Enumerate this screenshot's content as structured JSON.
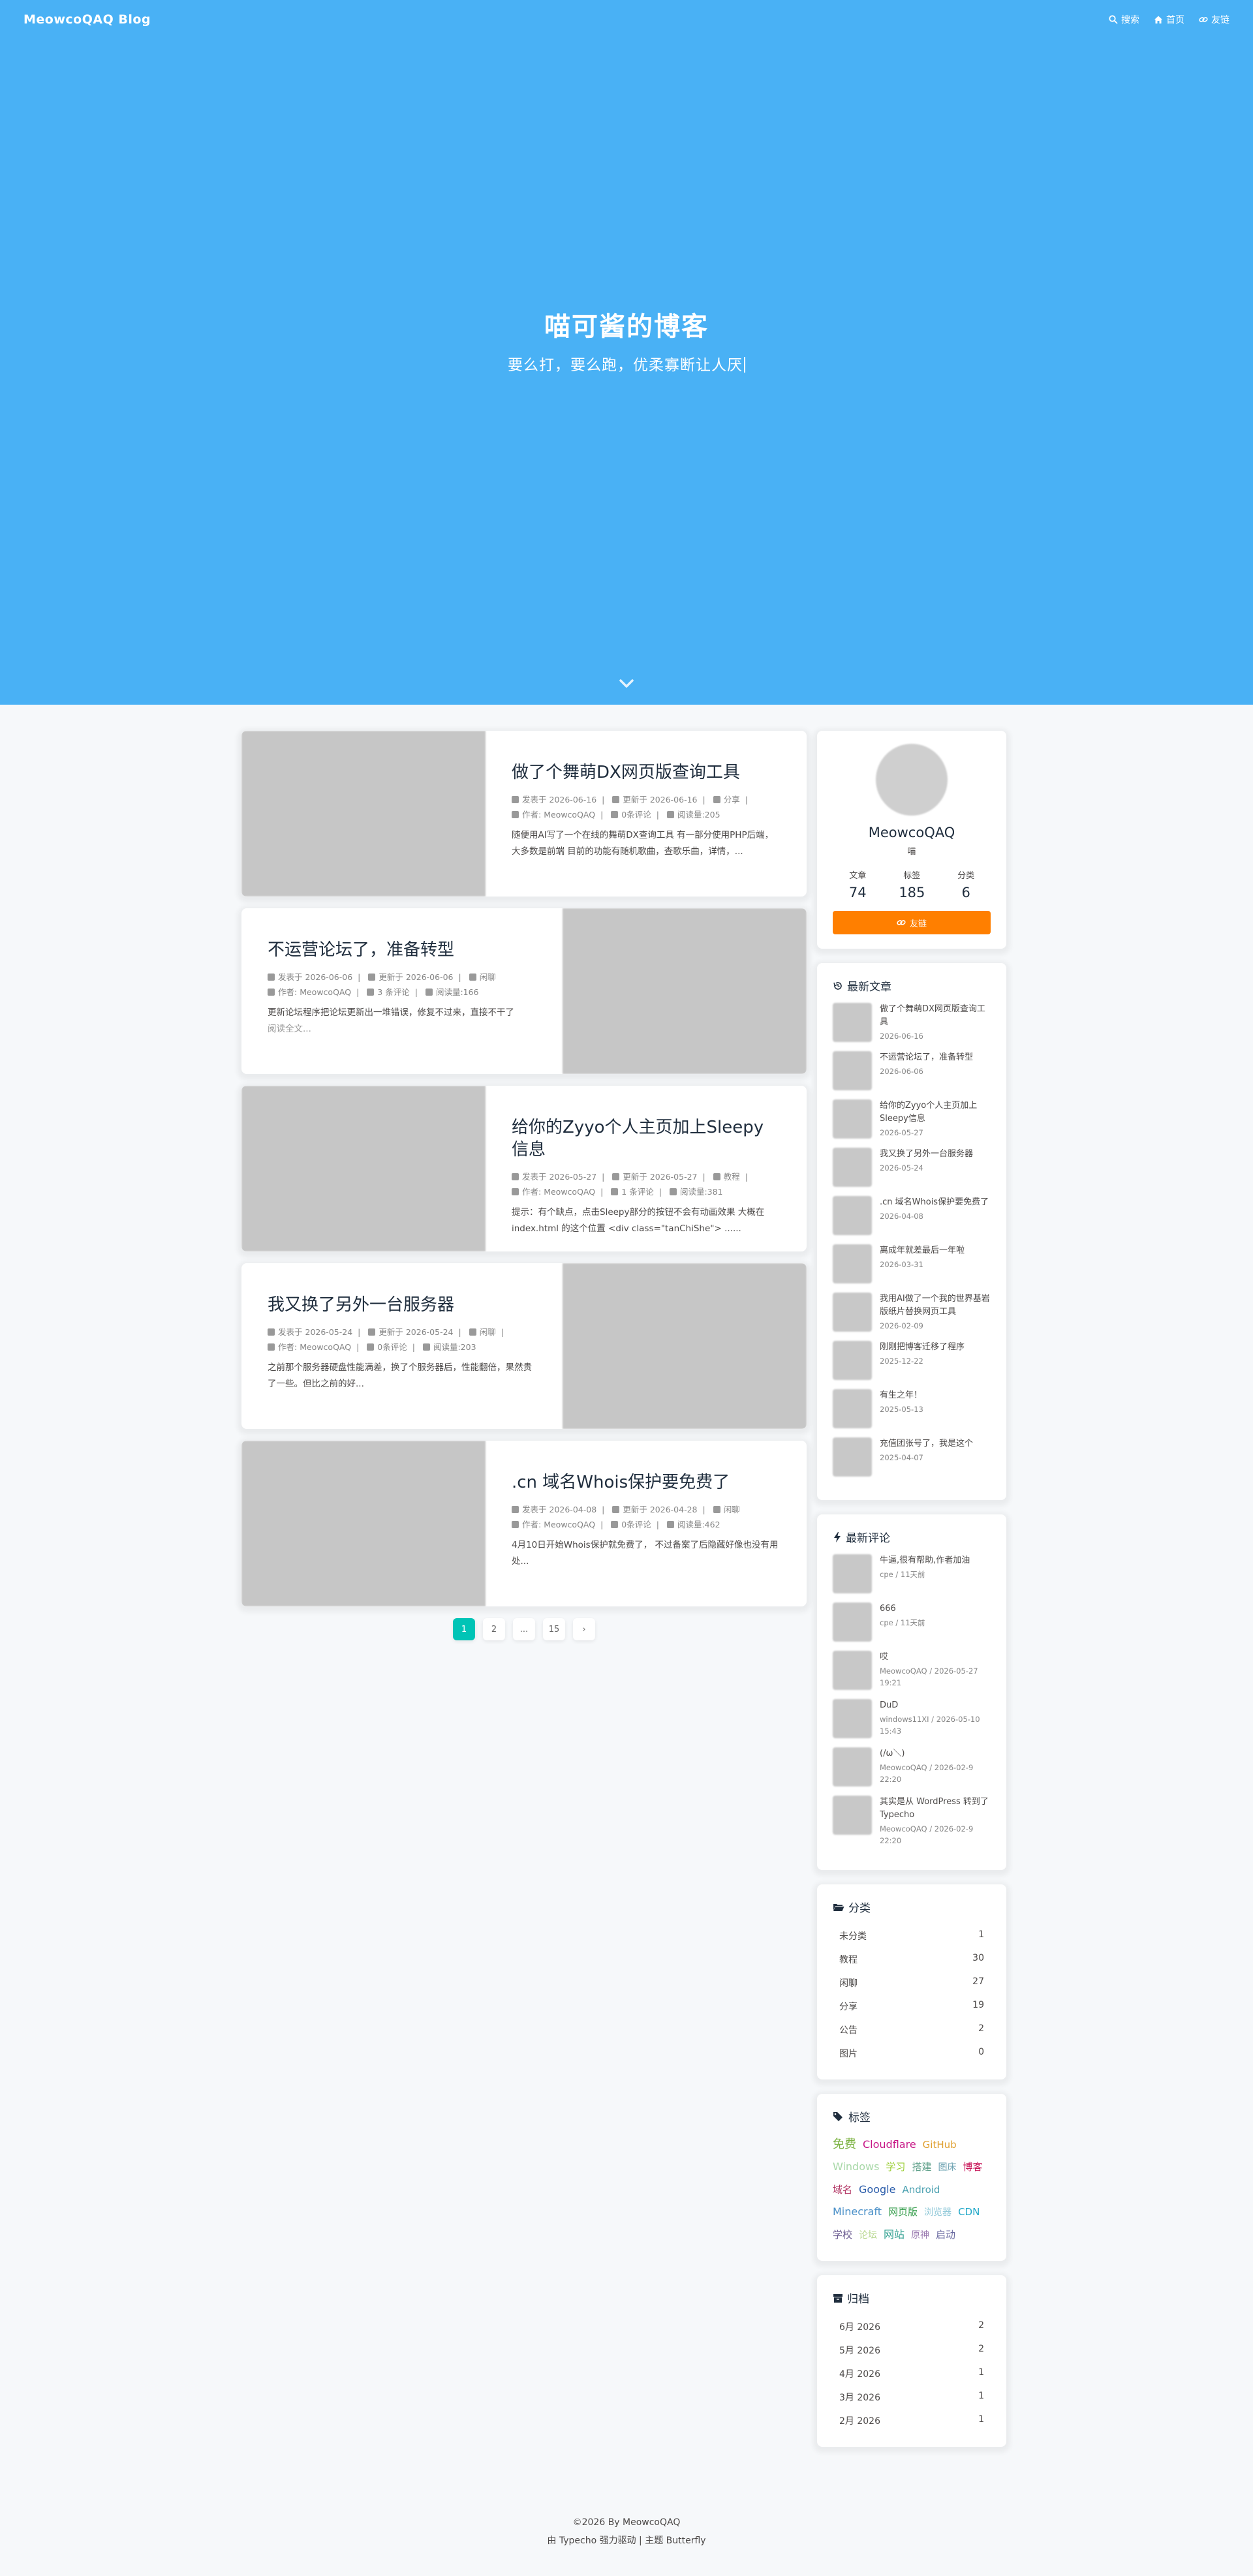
{
  "nav": {
    "brand": "MeowcoQAQ Blog",
    "search": "搜索",
    "home": "首页",
    "friends": "友链"
  },
  "hero": {
    "title": "喵可酱的博客",
    "subtitle": "要么打，要么跑，优柔寡断让人厌"
  },
  "posts": [
    {
      "title": "做了个舞萌DX网页版查询工具",
      "published": "2026-06-16",
      "updated": "2026-06-16",
      "category": "分享",
      "author": "MeowcoQAQ",
      "comments": "0条评论",
      "views": "阅读量:205",
      "excerpt": "随便用AI写了一个在线的舞萌DX查询工具 有一部分使用PHP后端，大多数是前端 目前的功能有随机歌曲，查歌乐曲，详情，...",
      "more": ""
    },
    {
      "title": "不运营论坛了，准备转型",
      "published": "2026-06-06",
      "updated": "2026-06-06",
      "category": "闲聊",
      "author": "MeowcoQAQ",
      "comments": "3 条评论",
      "views": "阅读量:166",
      "excerpt": "更新论坛程序把论坛更新出一堆错误，修复不过来，直接不干了",
      "more": "阅读全文..."
    },
    {
      "title": "给你的Zyyo个人主页加上Sleepy信息",
      "published": "2026-05-27",
      "updated": "2026-05-27",
      "category": "教程",
      "author": "MeowcoQAQ",
      "comments": "1 条评论",
      "views": "阅读量:381",
      "excerpt": "提示：有个缺点，点击Sleepy部分的按钮不会有动画效果 大概在index.html 的这个位置 <div class=\"tanChiShe\"> ......",
      "more": ""
    },
    {
      "title": "我又换了另外一台服务器",
      "published": "2026-05-24",
      "updated": "2026-05-24",
      "category": "闲聊",
      "author": "MeowcoQAQ",
      "comments": "0条评论",
      "views": "阅读量:203",
      "excerpt": "之前那个服务器硬盘性能满差，换了个服务器后，性能翻倍，果然贵了一些。但比之前的好...",
      "more": ""
    },
    {
      "title": ".cn 域名Whois保护要免费了",
      "published": "2026-04-08",
      "updated": "2026-04-28",
      "category": "闲聊",
      "author": "MeowcoQAQ",
      "comments": "0条评论",
      "views": "阅读量:462",
      "excerpt": "4月10日开始Whois保护就免费了， 不过备案了后隐藏好像也没有用处...",
      "more": ""
    }
  ],
  "meta_labels": {
    "published": "发表于",
    "updated": "更新于",
    "author": "作者:"
  },
  "pager": {
    "p1": "1",
    "p2": "2",
    "dots": "...",
    "last": "15",
    "next": "›"
  },
  "author": {
    "name": "MeowcoQAQ",
    "desc": "喵",
    "posts_label": "文章",
    "posts": "74",
    "tags_label": "标签",
    "tags": "185",
    "cats_label": "分类",
    "cats": "6",
    "link_btn": "友链"
  },
  "recent_posts": {
    "title": "最新文章",
    "items": [
      {
        "t": "做了个舞萌DX网页版查询工具",
        "d": "2026-06-16"
      },
      {
        "t": "不运营论坛了，准备转型",
        "d": "2026-06-06"
      },
      {
        "t": "给你的Zyyo个人主页加上Sleepy信息",
        "d": "2026-05-27"
      },
      {
        "t": "我又换了另外一台服务器",
        "d": "2026-05-24"
      },
      {
        "t": ".cn 域名Whois保护要免费了",
        "d": "2026-04-08"
      },
      {
        "t": "离成年就差最后一年啦",
        "d": "2026-03-31"
      },
      {
        "t": "我用AI做了一个我的世界基岩版纸片替换网页工具",
        "d": "2026-02-09"
      },
      {
        "t": "刚刚把博客迁移了程序",
        "d": "2025-12-22"
      },
      {
        "t": "有生之年！",
        "d": "2025-05-13"
      },
      {
        "t": "充值团张号了，我是这个",
        "d": "2025-04-07"
      }
    ]
  },
  "recent_comments": {
    "title": "最新评论",
    "items": [
      {
        "t": "牛逼,很有帮助,作者加油",
        "d": "cpe / 11天前"
      },
      {
        "t": "666",
        "d": "cpe / 11天前"
      },
      {
        "t": "哎",
        "d": "MeowcoQAQ / 2026-05-27 19:21"
      },
      {
        "t": "DuD",
        "d": "windows11XI / 2026-05-10 15:43"
      },
      {
        "t": "(/ω＼)",
        "d": "MeowcoQAQ / 2026-02-9 22:20"
      },
      {
        "t": "其实是从 WordPress 转到了 Typecho",
        "d": "MeowcoQAQ / 2026-02-9 22:20"
      }
    ]
  },
  "categories": {
    "title": "分类",
    "items": [
      {
        "name": "未分类",
        "count": "1"
      },
      {
        "name": "教程",
        "count": "30"
      },
      {
        "name": "闲聊",
        "count": "27"
      },
      {
        "name": "分享",
        "count": "19"
      },
      {
        "name": "公告",
        "count": "2"
      },
      {
        "name": "图片",
        "count": "0"
      }
    ]
  },
  "tags": {
    "title": "标签",
    "items": [
      {
        "name": "免费",
        "color": "#7cb342",
        "size": "18"
      },
      {
        "name": "Cloudflare",
        "color": "#c71585",
        "size": "16"
      },
      {
        "name": "GitHub",
        "color": "#e0a030",
        "size": "15"
      },
      {
        "name": "Windows",
        "color": "#a8d8a8",
        "size": "16"
      },
      {
        "name": "学习",
        "color": "#9acd32",
        "size": "15"
      },
      {
        "name": "搭建",
        "color": "#5fa08a",
        "size": "15"
      },
      {
        "name": "图床",
        "color": "#6aa0b0",
        "size": "14"
      },
      {
        "name": "博客",
        "color": "#c8195a",
        "size": "15"
      },
      {
        "name": "域名",
        "color": "#b03060",
        "size": "15"
      },
      {
        "name": "Google",
        "color": "#2a5caa",
        "size": "16"
      },
      {
        "name": "Android",
        "color": "#4aa0b0",
        "size": "15"
      },
      {
        "name": "Minecraft",
        "color": "#4a90c8",
        "size": "16"
      },
      {
        "name": "网页版",
        "color": "#3aa050",
        "size": "15"
      },
      {
        "name": "浏览器",
        "color": "#90c8d8",
        "size": "14"
      },
      {
        "name": "CDN",
        "color": "#20a8c8",
        "size": "15"
      },
      {
        "name": "学校",
        "color": "#6a5a90",
        "size": "15"
      },
      {
        "name": "论坛",
        "color": "#b8d890",
        "size": "14"
      },
      {
        "name": "网站",
        "color": "#30a090",
        "size": "16"
      },
      {
        "name": "原神",
        "color": "#9a7ab0",
        "size": "14"
      },
      {
        "name": "启动",
        "color": "#6a6aa0",
        "size": "15"
      }
    ]
  },
  "archives": {
    "title": "归档",
    "items": [
      {
        "name": "6月 2026",
        "count": "2"
      },
      {
        "name": "5月 2026",
        "count": "2"
      },
      {
        "name": "4月 2026",
        "count": "1"
      },
      {
        "name": "3月 2026",
        "count": "1"
      },
      {
        "name": "2月 2026",
        "count": "1"
      }
    ]
  },
  "footer": {
    "copy": "©2026 By MeowcoQAQ",
    "powered": "由 Typecho 强力驱动 | 主题 Butterfly"
  }
}
